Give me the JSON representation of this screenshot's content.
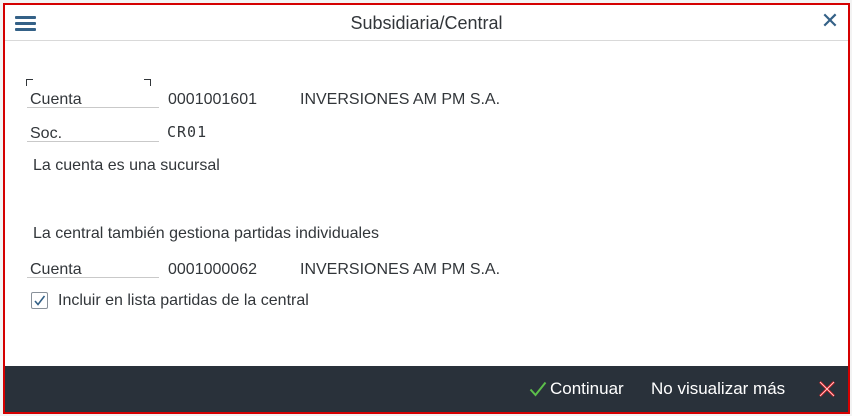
{
  "dialog": {
    "title": "Subsidiaria/Central",
    "menu_icon": "hamburger-menu-icon",
    "close_icon": "close-icon",
    "border_color": "#d40000"
  },
  "account": {
    "cuenta_label": "Cuenta",
    "cuenta_value": "0001001601",
    "cuenta_name": "INVERSIONES AM PM S.A.",
    "soc_label": "Soc.",
    "soc_value": "CR01",
    "branch_message": "La cuenta es una sucursal"
  },
  "central": {
    "heading": "La central también gestiona partidas individuales",
    "cuenta_label": "Cuenta",
    "cuenta_value": "0001000062",
    "cuenta_name": "INVERSIONES AM PM S.A.",
    "checkbox_label": "Incluir en lista partidas de la central",
    "checkbox_checked": true
  },
  "footer": {
    "continue_label": "Continuar",
    "continue_icon": "checkmark-icon",
    "no_show_label": "No visualizar más",
    "cancel_icon": "cancel-x-icon",
    "background": "#29313a",
    "accent_green": "#5cbf4a",
    "accent_red": "#e4262b"
  }
}
